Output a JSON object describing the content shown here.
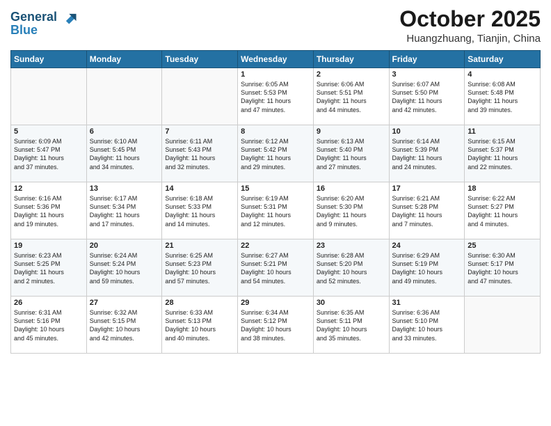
{
  "header": {
    "logo_line1": "General",
    "logo_line2": "Blue",
    "month": "October 2025",
    "location": "Huangzhuang, Tianjin, China"
  },
  "weekdays": [
    "Sunday",
    "Monday",
    "Tuesday",
    "Wednesday",
    "Thursday",
    "Friday",
    "Saturday"
  ],
  "weeks": [
    [
      {
        "day": "",
        "info": ""
      },
      {
        "day": "",
        "info": ""
      },
      {
        "day": "",
        "info": ""
      },
      {
        "day": "1",
        "info": "Sunrise: 6:05 AM\nSunset: 5:53 PM\nDaylight: 11 hours\nand 47 minutes."
      },
      {
        "day": "2",
        "info": "Sunrise: 6:06 AM\nSunset: 5:51 PM\nDaylight: 11 hours\nand 44 minutes."
      },
      {
        "day": "3",
        "info": "Sunrise: 6:07 AM\nSunset: 5:50 PM\nDaylight: 11 hours\nand 42 minutes."
      },
      {
        "day": "4",
        "info": "Sunrise: 6:08 AM\nSunset: 5:48 PM\nDaylight: 11 hours\nand 39 minutes."
      }
    ],
    [
      {
        "day": "5",
        "info": "Sunrise: 6:09 AM\nSunset: 5:47 PM\nDaylight: 11 hours\nand 37 minutes."
      },
      {
        "day": "6",
        "info": "Sunrise: 6:10 AM\nSunset: 5:45 PM\nDaylight: 11 hours\nand 34 minutes."
      },
      {
        "day": "7",
        "info": "Sunrise: 6:11 AM\nSunset: 5:43 PM\nDaylight: 11 hours\nand 32 minutes."
      },
      {
        "day": "8",
        "info": "Sunrise: 6:12 AM\nSunset: 5:42 PM\nDaylight: 11 hours\nand 29 minutes."
      },
      {
        "day": "9",
        "info": "Sunrise: 6:13 AM\nSunset: 5:40 PM\nDaylight: 11 hours\nand 27 minutes."
      },
      {
        "day": "10",
        "info": "Sunrise: 6:14 AM\nSunset: 5:39 PM\nDaylight: 11 hours\nand 24 minutes."
      },
      {
        "day": "11",
        "info": "Sunrise: 6:15 AM\nSunset: 5:37 PM\nDaylight: 11 hours\nand 22 minutes."
      }
    ],
    [
      {
        "day": "12",
        "info": "Sunrise: 6:16 AM\nSunset: 5:36 PM\nDaylight: 11 hours\nand 19 minutes."
      },
      {
        "day": "13",
        "info": "Sunrise: 6:17 AM\nSunset: 5:34 PM\nDaylight: 11 hours\nand 17 minutes."
      },
      {
        "day": "14",
        "info": "Sunrise: 6:18 AM\nSunset: 5:33 PM\nDaylight: 11 hours\nand 14 minutes."
      },
      {
        "day": "15",
        "info": "Sunrise: 6:19 AM\nSunset: 5:31 PM\nDaylight: 11 hours\nand 12 minutes."
      },
      {
        "day": "16",
        "info": "Sunrise: 6:20 AM\nSunset: 5:30 PM\nDaylight: 11 hours\nand 9 minutes."
      },
      {
        "day": "17",
        "info": "Sunrise: 6:21 AM\nSunset: 5:28 PM\nDaylight: 11 hours\nand 7 minutes."
      },
      {
        "day": "18",
        "info": "Sunrise: 6:22 AM\nSunset: 5:27 PM\nDaylight: 11 hours\nand 4 minutes."
      }
    ],
    [
      {
        "day": "19",
        "info": "Sunrise: 6:23 AM\nSunset: 5:25 PM\nDaylight: 11 hours\nand 2 minutes."
      },
      {
        "day": "20",
        "info": "Sunrise: 6:24 AM\nSunset: 5:24 PM\nDaylight: 10 hours\nand 59 minutes."
      },
      {
        "day": "21",
        "info": "Sunrise: 6:25 AM\nSunset: 5:23 PM\nDaylight: 10 hours\nand 57 minutes."
      },
      {
        "day": "22",
        "info": "Sunrise: 6:27 AM\nSunset: 5:21 PM\nDaylight: 10 hours\nand 54 minutes."
      },
      {
        "day": "23",
        "info": "Sunrise: 6:28 AM\nSunset: 5:20 PM\nDaylight: 10 hours\nand 52 minutes."
      },
      {
        "day": "24",
        "info": "Sunrise: 6:29 AM\nSunset: 5:19 PM\nDaylight: 10 hours\nand 49 minutes."
      },
      {
        "day": "25",
        "info": "Sunrise: 6:30 AM\nSunset: 5:17 PM\nDaylight: 10 hours\nand 47 minutes."
      }
    ],
    [
      {
        "day": "26",
        "info": "Sunrise: 6:31 AM\nSunset: 5:16 PM\nDaylight: 10 hours\nand 45 minutes."
      },
      {
        "day": "27",
        "info": "Sunrise: 6:32 AM\nSunset: 5:15 PM\nDaylight: 10 hours\nand 42 minutes."
      },
      {
        "day": "28",
        "info": "Sunrise: 6:33 AM\nSunset: 5:13 PM\nDaylight: 10 hours\nand 40 minutes."
      },
      {
        "day": "29",
        "info": "Sunrise: 6:34 AM\nSunset: 5:12 PM\nDaylight: 10 hours\nand 38 minutes."
      },
      {
        "day": "30",
        "info": "Sunrise: 6:35 AM\nSunset: 5:11 PM\nDaylight: 10 hours\nand 35 minutes."
      },
      {
        "day": "31",
        "info": "Sunrise: 6:36 AM\nSunset: 5:10 PM\nDaylight: 10 hours\nand 33 minutes."
      },
      {
        "day": "",
        "info": ""
      }
    ]
  ]
}
